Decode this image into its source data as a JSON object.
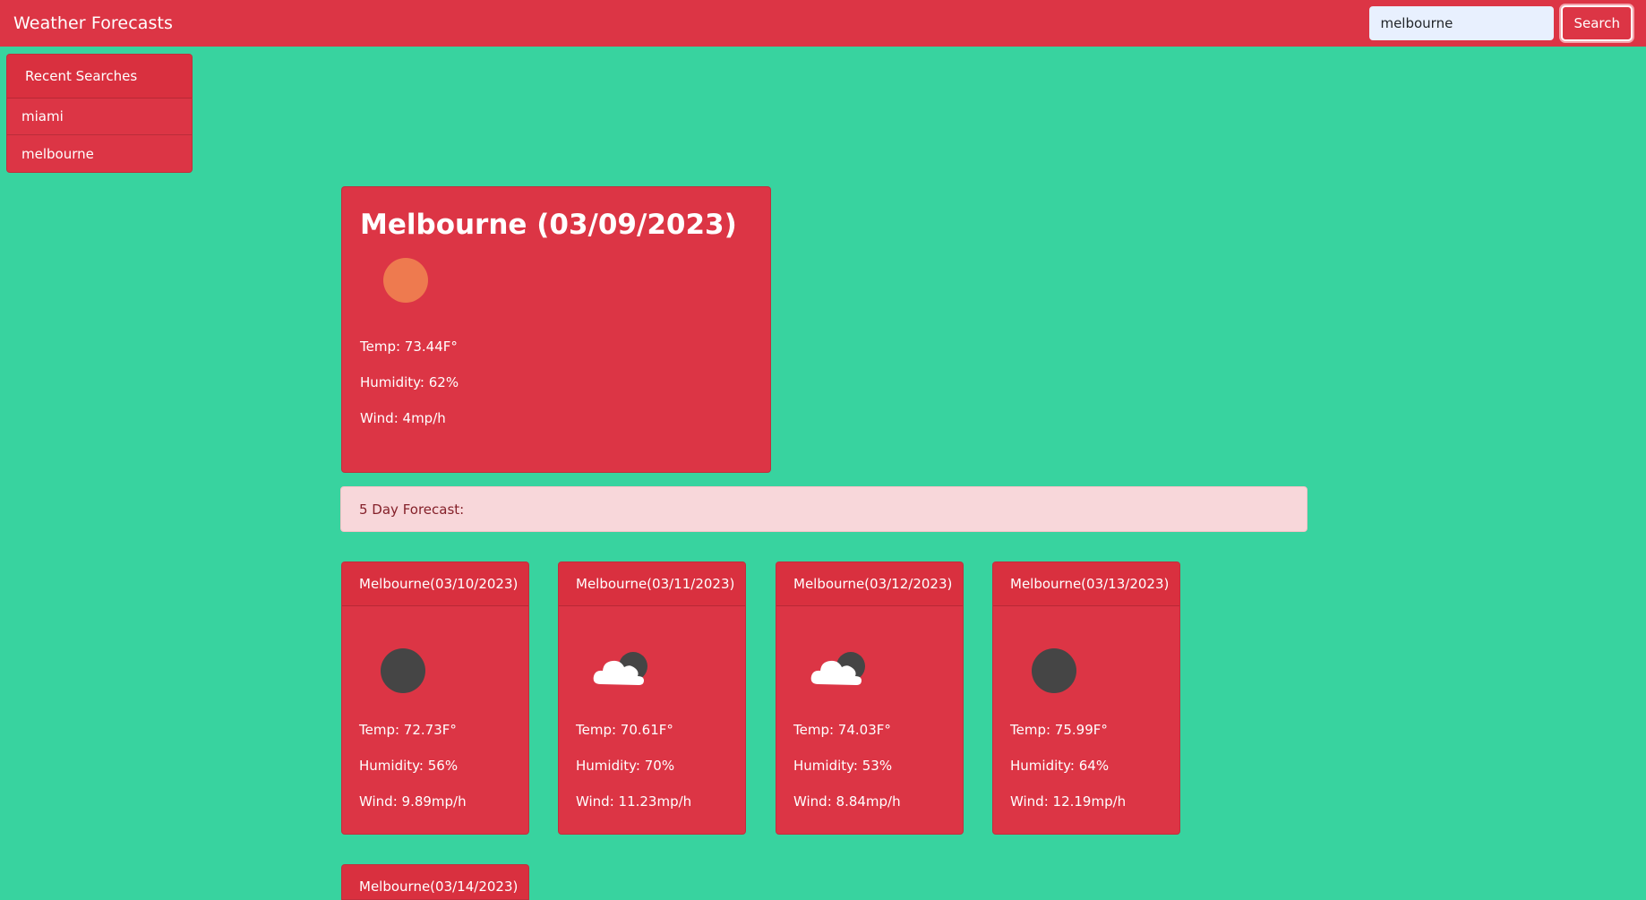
{
  "navbar": {
    "brand": "Weather Forecasts",
    "search_value": "melbourne",
    "search_button": "Search"
  },
  "recent": {
    "header": "Recent Searches",
    "items": [
      "miami",
      "melbourne"
    ]
  },
  "current": {
    "title": "Melbourne (03/09/2023)",
    "icon": "sun-icon",
    "temp": "Temp: 73.44F°",
    "humidity": "Humidity: 62%",
    "wind": "Wind: 4mp/h"
  },
  "forecast_banner": "5 Day Forecast:",
  "forecast": [
    {
      "title": "Melbourne(03/10/2023)",
      "icon": "moon-icon",
      "temp": "Temp: 72.73F°",
      "humidity": "Humidity: 56%",
      "wind": "Wind: 9.89mp/h"
    },
    {
      "title": "Melbourne(03/11/2023)",
      "icon": "cloudy-night-icon",
      "temp": "Temp: 70.61F°",
      "humidity": "Humidity: 70%",
      "wind": "Wind: 11.23mp/h"
    },
    {
      "title": "Melbourne(03/12/2023)",
      "icon": "cloudy-night-icon",
      "temp": "Temp: 74.03F°",
      "humidity": "Humidity: 53%",
      "wind": "Wind: 8.84mp/h"
    },
    {
      "title": "Melbourne(03/13/2023)",
      "icon": "moon-icon",
      "temp": "Temp: 75.99F°",
      "humidity": "Humidity: 64%",
      "wind": "Wind: 12.19mp/h"
    },
    {
      "title": "Melbourne(03/14/2023)",
      "icon": "",
      "temp": "",
      "humidity": "",
      "wind": ""
    }
  ],
  "colors": {
    "background": "#38d39f",
    "card": "#dc3545",
    "banner": "#f8d7da",
    "banner_text": "#842029",
    "sun": "#ee7a4f",
    "moon": "#454545"
  }
}
